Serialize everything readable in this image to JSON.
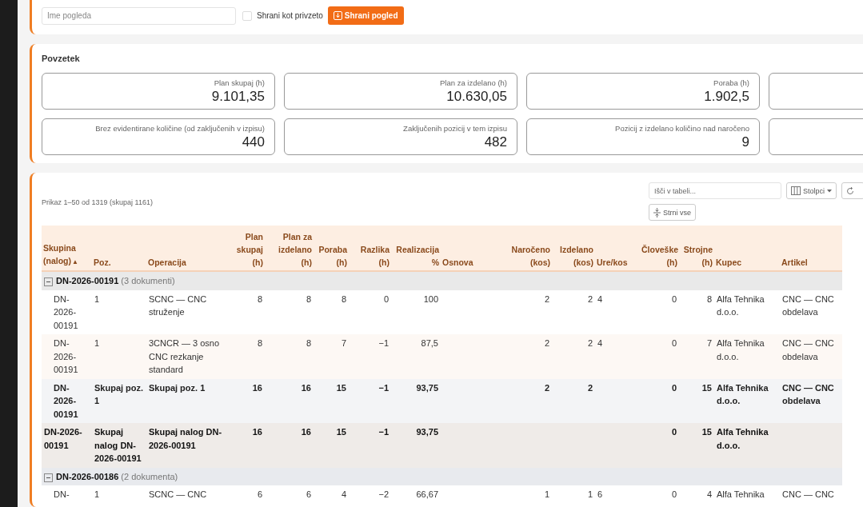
{
  "view_bar": {
    "name_field": {
      "placeholder": "Ime pogleda"
    },
    "default_checkbox": {
      "label": "Shrani kot privzeto",
      "checked": false
    },
    "save_button": "Shrani pogled"
  },
  "summary": {
    "title": "Povzetek",
    "tiles": [
      {
        "kind": "metric",
        "label": "Plan skupaj (h)",
        "value": "9.101,35"
      },
      {
        "kind": "metric",
        "label": "Plan za izdelano (h)",
        "value": "10.630,05"
      },
      {
        "kind": "metric",
        "label": "Poraba (h)",
        "value": "1.902,5"
      },
      {
        "kind": "blank"
      },
      {
        "kind": "metric",
        "label": "Brez evidentirane količine (od zaključenih v izpisu)",
        "value": "440"
      },
      {
        "kind": "metric",
        "label": "Zaključenih pozicij v tem izpisu",
        "value": "482"
      },
      {
        "kind": "metric",
        "label": "Pozicij z izdelano količino nad naročeno",
        "value": "9"
      },
      {
        "kind": "blank"
      }
    ]
  },
  "table": {
    "info": "Prikaz 1–50 od 1319 (skupaj 1161)",
    "search": {
      "placeholder": "Išči v tabeli..."
    },
    "columns_button": "Stolpci",
    "collapse_button": "Strni vse",
    "columns": [
      {
        "label": "Skupina (nalog)",
        "kind": "text",
        "sort": "▲"
      },
      {
        "label": "Poz.",
        "kind": "text"
      },
      {
        "label": "Operacija",
        "kind": "text"
      },
      {
        "label": "Plan skupaj (h)",
        "kind": "number"
      },
      {
        "label": "Plan za izdelano (h)",
        "kind": "number"
      },
      {
        "label": "Poraba (h)",
        "kind": "number"
      },
      {
        "label": "Razlika (h)",
        "kind": "number"
      },
      {
        "label": "Realizacija %",
        "kind": "number"
      },
      {
        "label": "Osnova",
        "kind": "text"
      },
      {
        "label": "Naročeno (kos)",
        "kind": "number"
      },
      {
        "label": "Izdelano (kos)",
        "kind": "number"
      },
      {
        "label": "Ure/kos",
        "kind": "text"
      },
      {
        "label": "Človeške (h)",
        "kind": "number"
      },
      {
        "label": "Strojne (h)",
        "kind": "number"
      },
      {
        "label": "Kupec",
        "kind": "text"
      },
      {
        "label": "Artikel",
        "kind": "text"
      }
    ],
    "rows": [
      {
        "kind": "group",
        "label": "DN-2026-00191",
        "count": "(3 dokumenti)",
        "expanded": true
      },
      {
        "kind": "item",
        "cells": [
          "DN-2026-00191",
          "1",
          "SCNC — CNC struženje",
          "8",
          "8",
          "8",
          "0",
          "100",
          null,
          "2",
          "2",
          "4",
          "0",
          "8",
          "Alfa Tehnika d.o.o.",
          "CNC — CNC obdelava"
        ]
      },
      {
        "kind": "item",
        "cells": [
          "DN-2026-00191",
          "1",
          "3CNCR — 3 osno CNC rezkanje standard",
          "8",
          "8",
          "7",
          "−1",
          "87,5",
          null,
          "2",
          "2",
          "4",
          "0",
          "7",
          "Alfa Tehnika d.o.o.",
          "CNC — CNC obdelava"
        ]
      },
      {
        "kind": "subtotal",
        "cells": [
          "DN-2026-00191",
          "Skupaj poz. 1",
          "Skupaj poz. 1",
          "16",
          "16",
          "15",
          "−1",
          "93,75",
          null,
          "2",
          "2",
          null,
          "0",
          "15",
          "Alfa Tehnika d.o.o.",
          "CNC — CNC obdelava"
        ]
      },
      {
        "kind": "total",
        "cells": [
          "DN-2026-00191",
          "Skupaj nalog DN-2026-00191",
          "Skupaj nalog DN-2026-00191",
          "16",
          "16",
          "15",
          "−1",
          "93,75",
          null,
          null,
          null,
          null,
          "0",
          "15",
          "Alfa Tehnika d.o.o.",
          null
        ]
      },
      {
        "kind": "group",
        "label": "DN-2026-00186",
        "count": "(2 dokumenta)",
        "expanded": true
      },
      {
        "kind": "item",
        "cells": [
          "DN-",
          "1",
          "SCNC — CNC",
          "6",
          "6",
          "4",
          "−2",
          "66,67",
          null,
          "1",
          "1",
          "6",
          "0",
          "4",
          "Alfa Tehnika",
          "CNC — CNC"
        ]
      }
    ]
  }
}
